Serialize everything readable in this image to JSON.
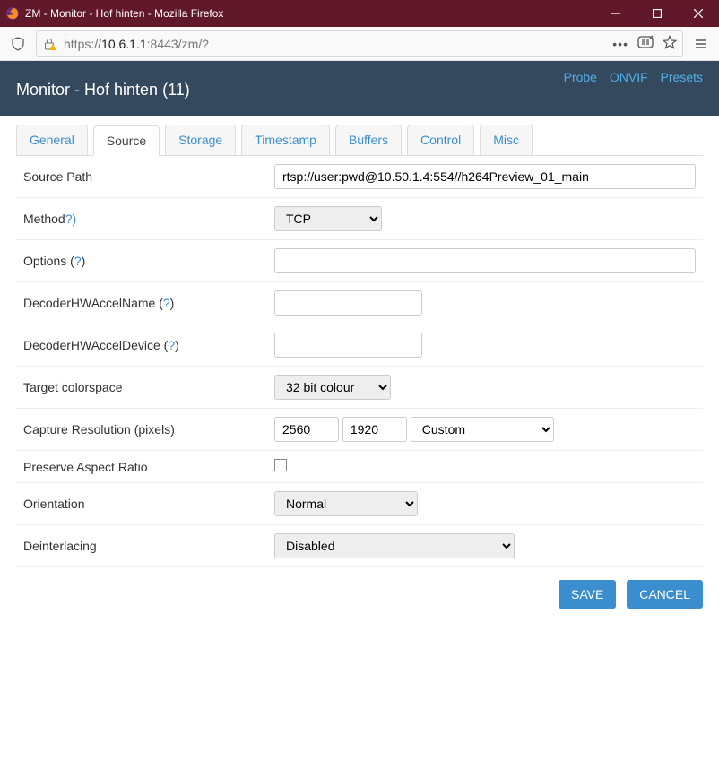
{
  "window": {
    "title": "ZM - Monitor - Hof hinten - Mozilla Firefox"
  },
  "url": {
    "host": "10.6.1.1",
    "rest": ":8443/zm/?",
    "scheme": "https://"
  },
  "header": {
    "title": "Monitor - Hof hinten (11)",
    "links": {
      "probe": "Probe",
      "onvif": "ONVIF",
      "presets": "Presets"
    }
  },
  "tabs": {
    "general": "General",
    "source": "Source",
    "storage": "Storage",
    "timestamp": "Timestamp",
    "buffers": "Buffers",
    "control": "Control",
    "misc": "Misc"
  },
  "fields": {
    "source_path": {
      "label": "Source Path",
      "value": "rtsp://user:pwd@10.50.1.4:554//h264Preview_01_main"
    },
    "method": {
      "label": "Method",
      "value": "TCP",
      "help": "?)"
    },
    "options": {
      "label": "Options (",
      "help": "?",
      "close": ")",
      "value": ""
    },
    "decname": {
      "label": "DecoderHWAccelName (",
      "help": "?",
      "close": ")",
      "value": ""
    },
    "decdev": {
      "label": "DecoderHWAccelDevice (",
      "help": "?",
      "close": ")",
      "value": ""
    },
    "colorspace": {
      "label": "Target colorspace",
      "value": "32 bit colour"
    },
    "capres": {
      "label": "Capture Resolution (pixels)",
      "w": "2560",
      "h": "1920",
      "preset": "Custom"
    },
    "aspect": {
      "label": "Preserve Aspect Ratio",
      "checked": false
    },
    "orientation": {
      "label": "Orientation",
      "value": "Normal"
    },
    "deinterlace": {
      "label": "Deinterlacing",
      "value": "Disabled"
    }
  },
  "buttons": {
    "save": "SAVE",
    "cancel": "CANCEL"
  }
}
